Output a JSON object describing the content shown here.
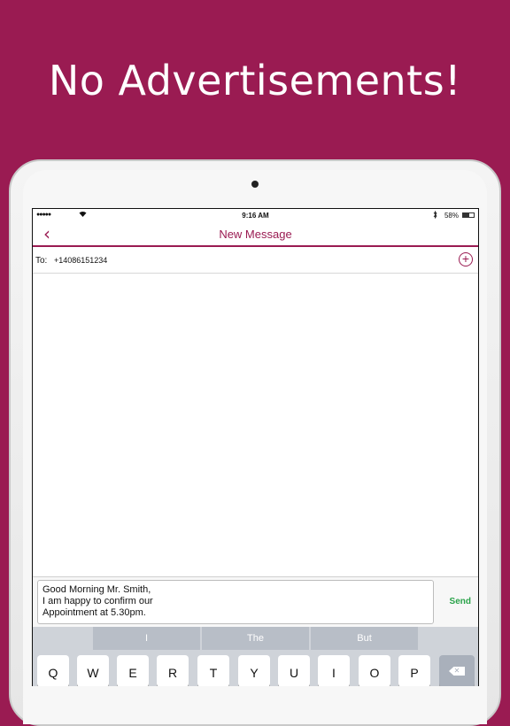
{
  "headline": "No Advertisements!",
  "status_bar": {
    "signal": "●●●●●",
    "wifi_icon": "wifi-icon",
    "time": "9:16 AM",
    "bluetooth_icon": "bluetooth-icon",
    "battery_percent": "58%",
    "battery_level": 0.58
  },
  "nav": {
    "back_glyph": "‹",
    "title": "New Message"
  },
  "recipient": {
    "label": "To:",
    "value": "+14086151234",
    "add_glyph": "+"
  },
  "compose": {
    "text": "Good Morning Mr. Smith,\nI am happy to confirm our\nAppointment at 5.30pm.",
    "send_label": "Send"
  },
  "keyboard": {
    "suggestions": [
      "I",
      "The",
      "But"
    ],
    "keys": [
      "Q",
      "W",
      "E",
      "R",
      "T",
      "Y",
      "U",
      "I",
      "O",
      "P"
    ],
    "backspace_glyph": "✕"
  },
  "colors": {
    "brand": "#9a1b52",
    "send": "#2aa34a"
  }
}
